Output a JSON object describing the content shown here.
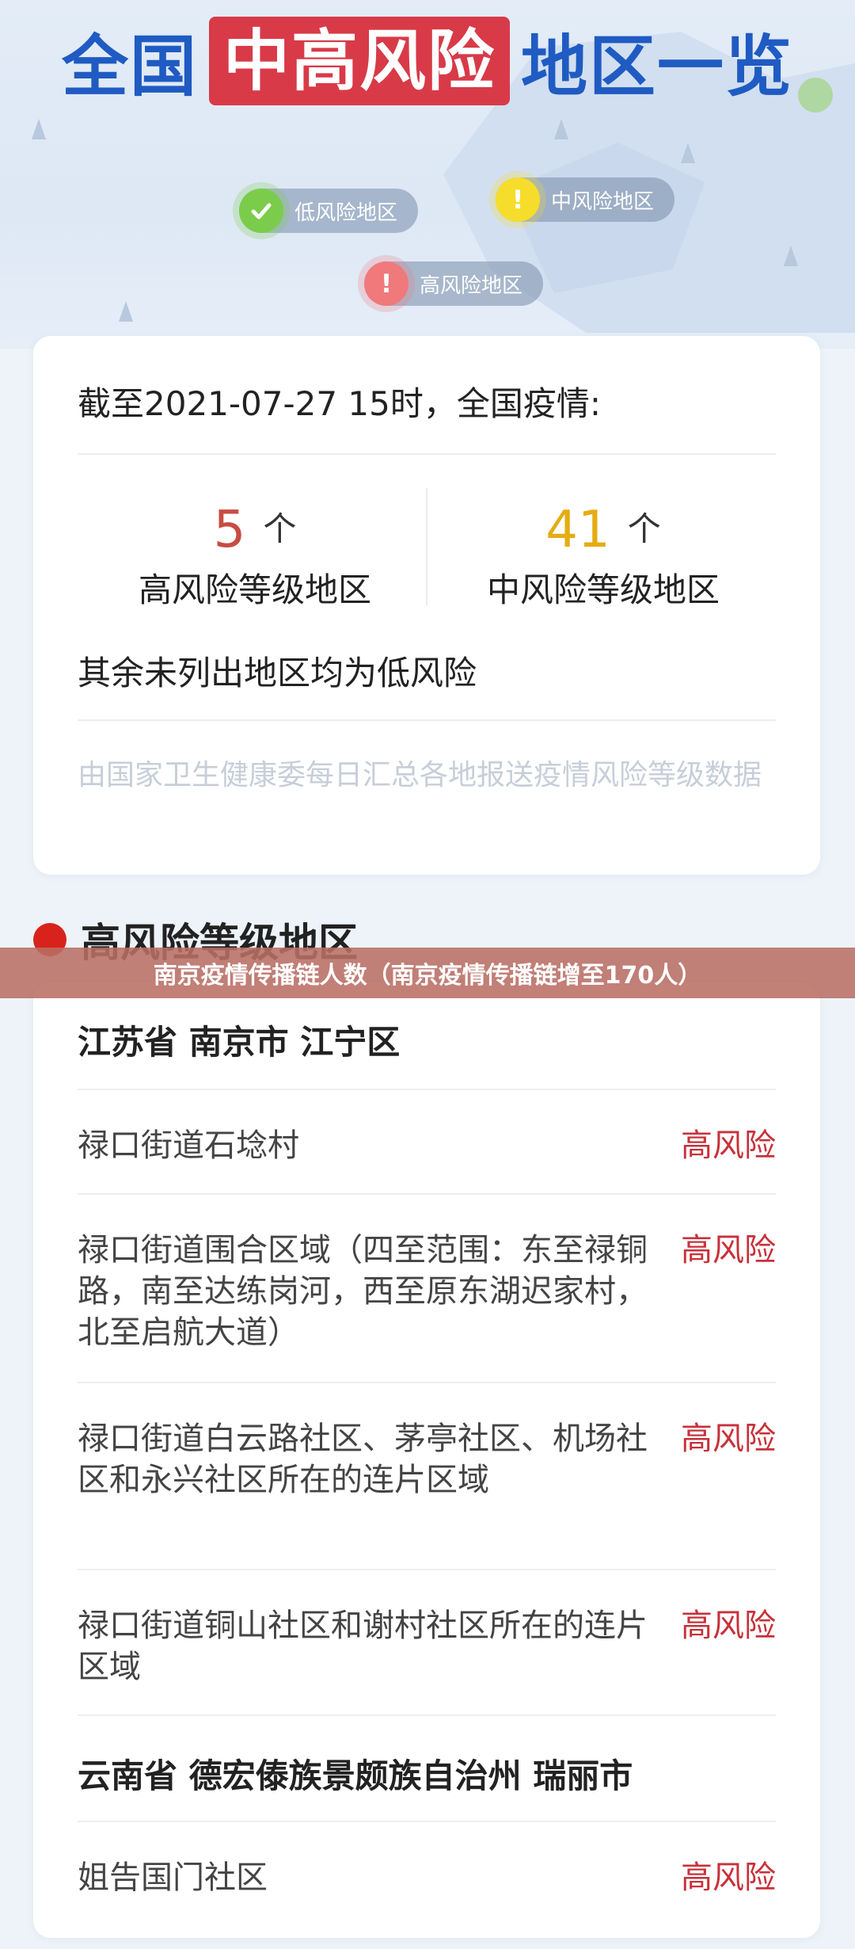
{
  "banner": {
    "title_prefix": "全国",
    "title_highlight": "中高风险",
    "title_suffix": "地区一览",
    "legend_low": "低风险地区",
    "legend_mid": "中风险地区",
    "legend_high": "高风险地区",
    "legend_mid_mark": "!",
    "legend_high_mark": "!"
  },
  "summary": {
    "heading": "截至2021-07-27 15时，全国疫情:",
    "high_count": "5",
    "high_unit": "个",
    "high_label": "高风险等级地区",
    "mid_count": "41",
    "mid_unit": "个",
    "mid_label": "中风险等级地区",
    "rest_note": "其余未列出地区均为低风险",
    "source_note": "由国家卫生健康委每日汇总各地报送疫情风险等级数据"
  },
  "caption": "南京疫情传播链人数（南京疫情传播链增至170人）",
  "high_section": {
    "title": "高风险等级地区",
    "group1_title": "江苏省 南京市 江宁区",
    "rows": [
      {
        "area": "禄口街道石埝村",
        "level": "高风险"
      },
      {
        "area": "禄口街道围合区域（四至范围：东至禄铜路，南至达练岗河，西至原东湖迟家村，北至启航大道）",
        "level": "高风险"
      },
      {
        "area": "禄口街道白云路社区、茅亭社区、机场社区和永兴社区所在的连片区域",
        "level": "高风险"
      },
      {
        "area": "禄口街道铜山社区和谢村社区所在的连片区域",
        "level": "高风险"
      }
    ],
    "group2_title": "云南省 德宏傣族景颇族自治州 瑞丽市",
    "group2_rows": [
      {
        "area": "姐告国门社区",
        "level": "高风险"
      }
    ]
  },
  "colors": {
    "title_blue": "#1f5bc2",
    "highlight_red": "#d83a48",
    "high_number": "#c84c42",
    "mid_number": "#e5ac12",
    "risk_text": "#c8313a",
    "section_dot": "#d8231c"
  },
  "icons": {
    "legend_low": "check-icon",
    "legend_mid": "exclamation-icon",
    "legend_high": "exclamation-icon",
    "section": "red-dot-icon"
  }
}
